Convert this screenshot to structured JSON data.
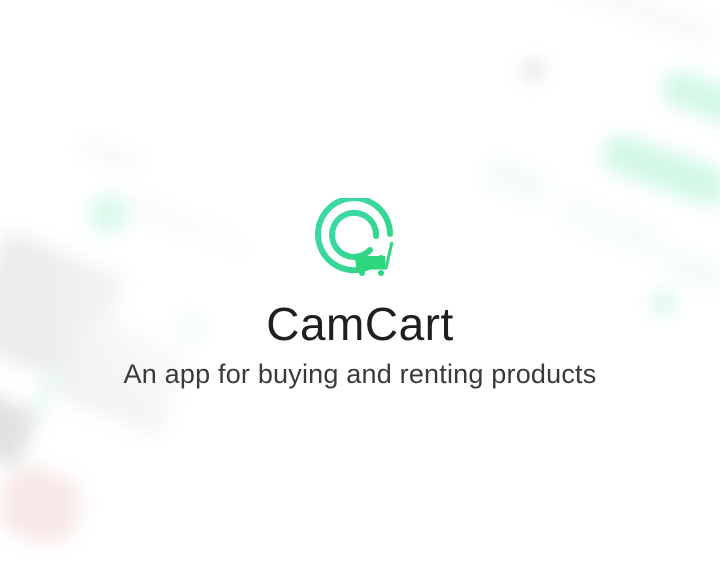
{
  "app": {
    "name": "CamCart",
    "tagline": "An app for buying and renting products"
  },
  "logo": {
    "icon": "cart-ring-logo",
    "ring_color": "#3fe0a8",
    "cart_color": "#2ed67f"
  },
  "background": {
    "description_icon": "blurred-app-screens-icon",
    "accent_color": "#4fe3a2"
  }
}
